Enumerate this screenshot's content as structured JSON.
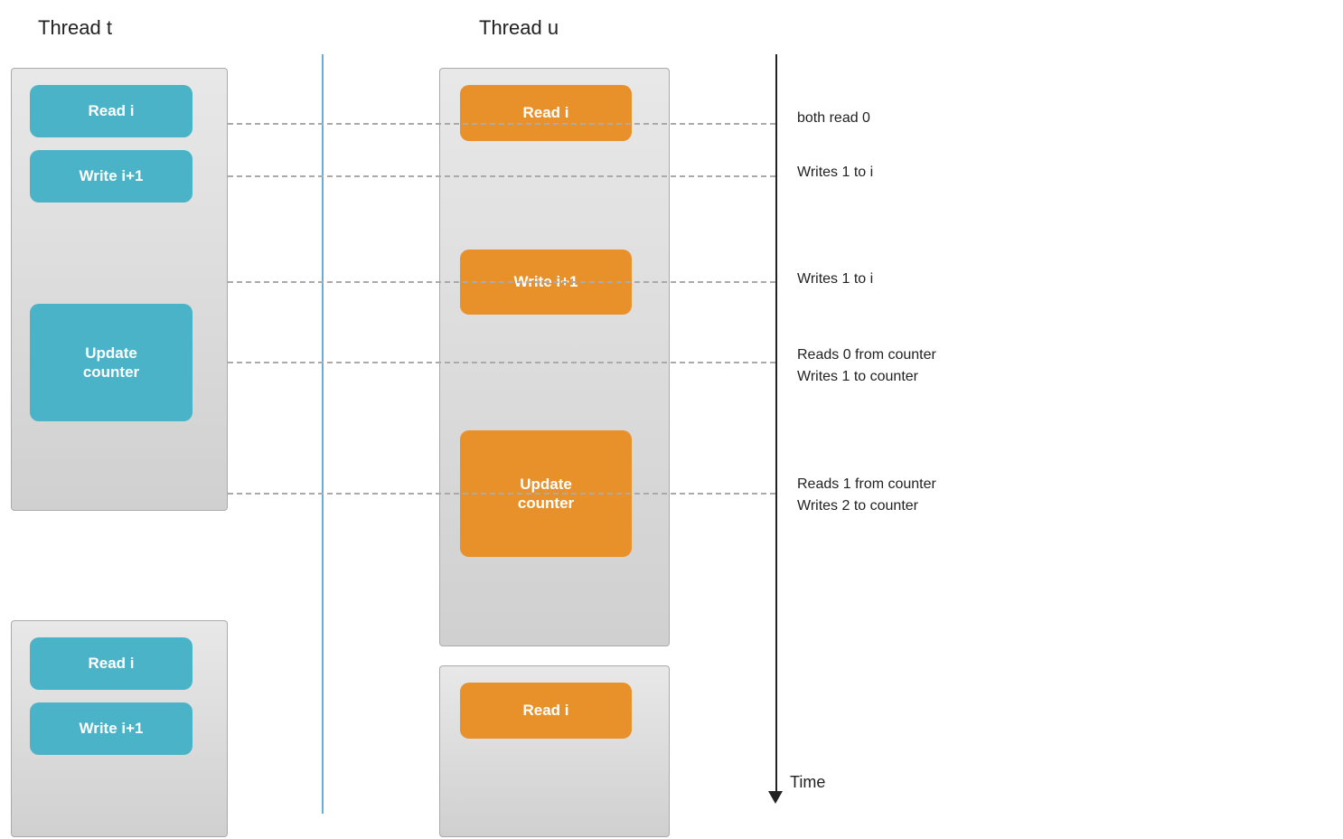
{
  "threads": {
    "t_label": "Thread t",
    "u_label": "Thread u"
  },
  "buttons": {
    "read_i": "Read i",
    "write_i1": "Write i+1",
    "update_counter": "Update\ncounter"
  },
  "annotations": {
    "row1": "both read 0",
    "row2": "Writes 1 to i",
    "row3": "Writes 1 to i",
    "row4a": "Reads 0 from counter",
    "row4b": "Writes 1 to counter",
    "row5a": "Reads 1 from counter",
    "row5b": "Writes 2 to counter"
  },
  "time_label": "Time"
}
